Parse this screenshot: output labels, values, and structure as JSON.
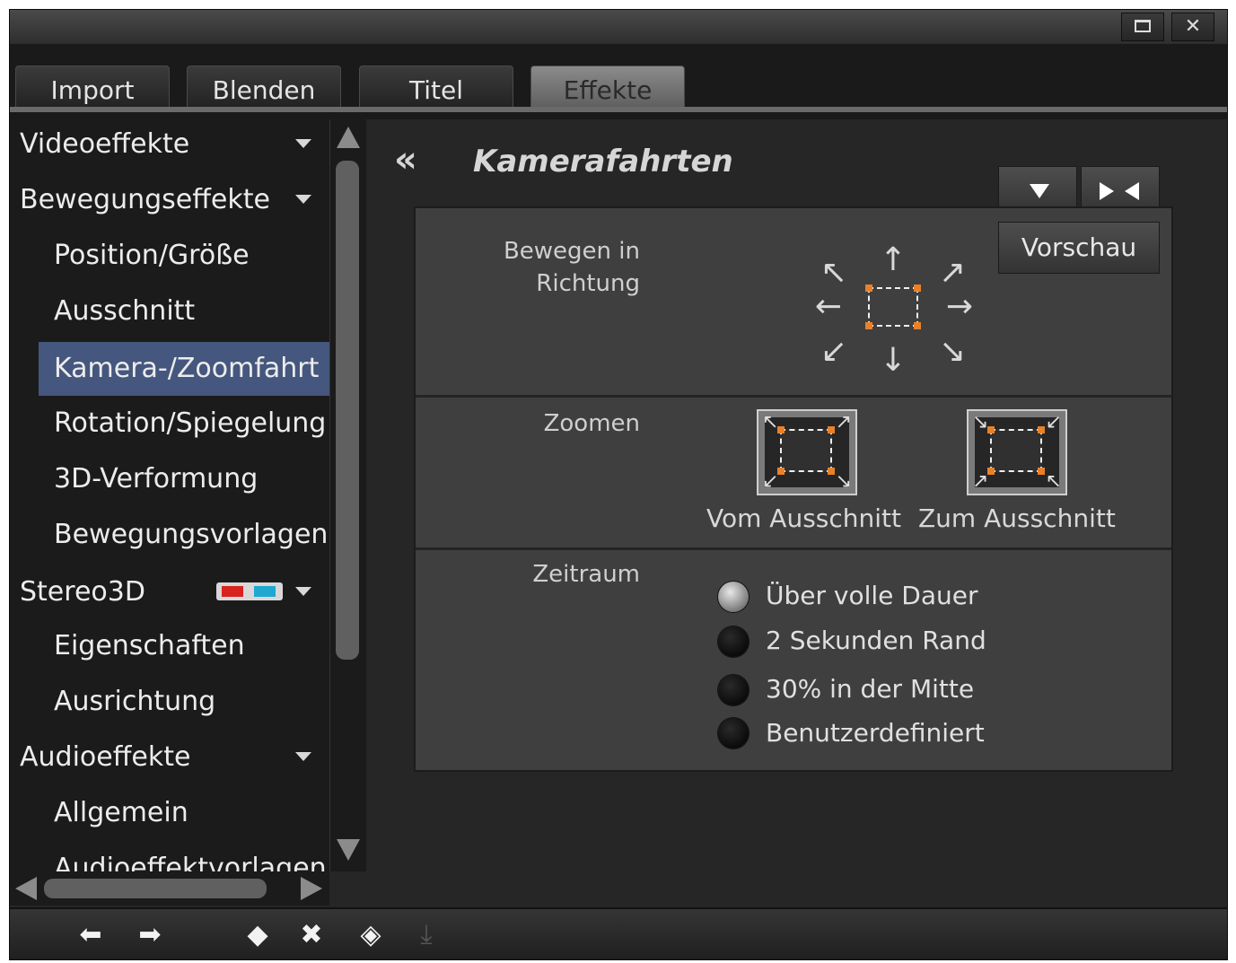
{
  "tabs": [
    "Import",
    "Blenden",
    "Titel",
    "Effekte"
  ],
  "active_tab": "Effekte",
  "sidebar": {
    "items": [
      {
        "label": "Videoeffekte",
        "level": "category",
        "expandable": true
      },
      {
        "label": "Bewegungseffekte",
        "level": "category",
        "expandable": true
      },
      {
        "label": "Position/Größe",
        "level": "sub"
      },
      {
        "label": "Ausschnitt",
        "level": "sub"
      },
      {
        "label": "Kamera-/Zoomfahrt",
        "level": "sub",
        "selected": true
      },
      {
        "label": "Rotation/Spiegelung",
        "level": "sub"
      },
      {
        "label": "3D-Verformung",
        "level": "sub"
      },
      {
        "label": "Bewegungsvorlagen",
        "level": "sub"
      },
      {
        "label": "Stereo3D",
        "level": "category",
        "expandable": true,
        "icon": "3d-glasses-icon"
      },
      {
        "label": "Eigenschaften",
        "level": "sub"
      },
      {
        "label": "Ausrichtung",
        "level": "sub"
      },
      {
        "label": "Audioeffekte",
        "level": "category",
        "expandable": true
      },
      {
        "label": "Allgemein",
        "level": "sub"
      },
      {
        "label": "Audioeffektvorlagen",
        "level": "sub"
      }
    ]
  },
  "main": {
    "collapse_glyph": "«",
    "title": "Kamerafahrten",
    "preview_label": "Vorschau",
    "move_label_line1": "Bewegen in",
    "move_label_line2": "Richtung",
    "zoom_label": "Zoomen",
    "zoom_from_label": "Vom Ausschnitt",
    "zoom_to_label": "Zum Ausschnitt",
    "timespan_label": "Zeitraum",
    "timespan_options": [
      {
        "label": "Über volle Dauer",
        "selected": true
      },
      {
        "label": "2 Sekunden Rand",
        "selected": false
      },
      {
        "label": "30% in der Mitte",
        "selected": false
      },
      {
        "label": "Benutzerdefiniert",
        "selected": false
      }
    ]
  },
  "window_controls": {
    "close_glyph": "✕"
  },
  "colors": {
    "selection": "#45577e",
    "accent_orange": "#e8812a",
    "background": "#262626"
  }
}
